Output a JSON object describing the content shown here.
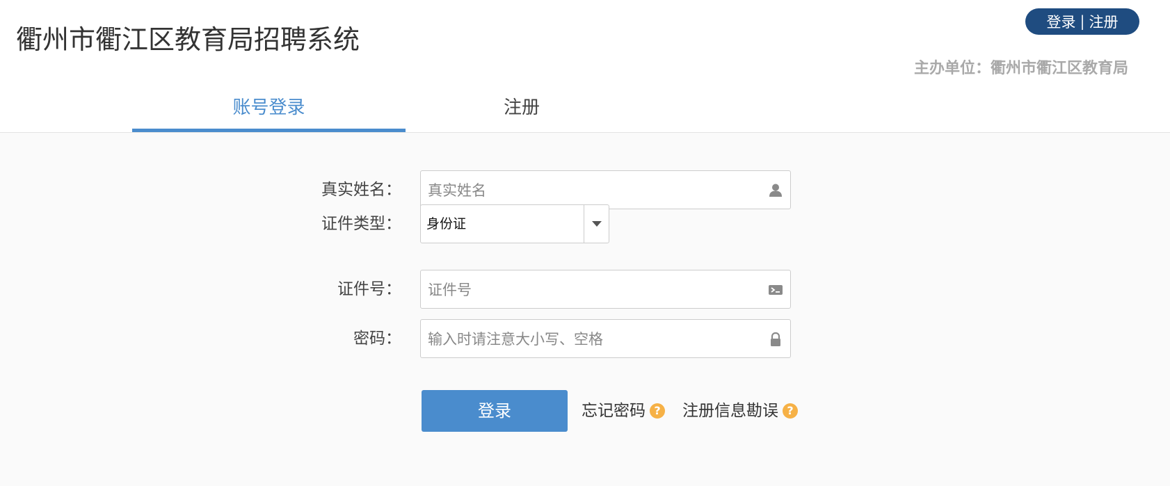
{
  "header": {
    "site_title": "衢州市衢江区教育局招聘系统",
    "auth_login": "登录",
    "auth_separator": "|",
    "auth_register": "注册",
    "sponsor": "主办单位：衢州市衢江区教育局"
  },
  "tabs": [
    {
      "label": "账号登录",
      "active": true
    },
    {
      "label": "注册",
      "active": false
    }
  ],
  "form": {
    "real_name": {
      "label": "真实姓名：",
      "placeholder": "真实姓名",
      "icon": "user-icon"
    },
    "id_type": {
      "label": "证件类型：",
      "value": "身份证",
      "icon": "caret-down-icon"
    },
    "id_number": {
      "label": "证件号：",
      "placeholder": "证件号",
      "icon": "id-card-icon"
    },
    "password": {
      "label": "密码：",
      "placeholder": "输入时请注意大小写、空格",
      "icon": "lock-icon"
    }
  },
  "actions": {
    "login_label": "登录",
    "forgot_password": "忘记密码",
    "correct_info": "注册信息勘误",
    "help_icon": "question-icon"
  },
  "colors": {
    "accent": "#4a8ccd",
    "header_button": "#1f4c80",
    "help_icon": "#f6b146",
    "sponsor_text": "#a9a9a9"
  }
}
